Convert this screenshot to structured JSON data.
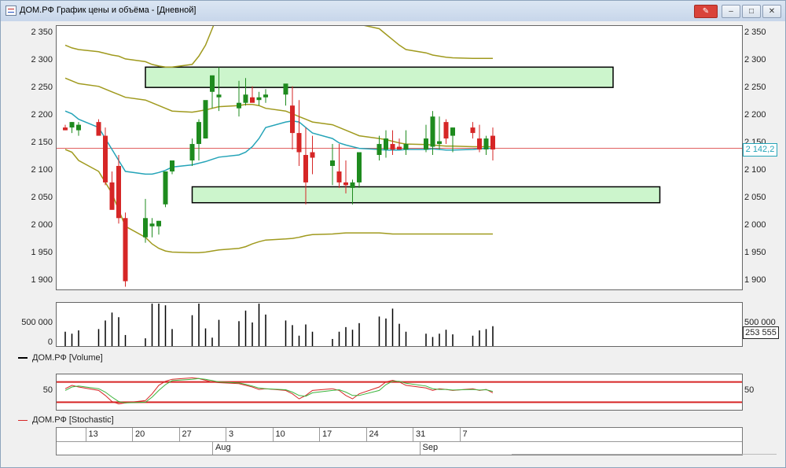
{
  "window": {
    "title": "ДОМ.РФ График цены и объёма - [Дневной]",
    "pin_icon": "pin-icon",
    "controls": {
      "minimize": "–",
      "maximize": "□",
      "close": "✕"
    }
  },
  "price_axis": {
    "ticks": [
      "2 350",
      "2 300",
      "2 250",
      "2 200",
      "2 150",
      "2 100",
      "2 050",
      "2 000",
      "1 950",
      "1 900"
    ],
    "last_price": "2 142,2",
    "last_price_color": "#25a4b8"
  },
  "volume_pane": {
    "ticks": [
      "500 000",
      "0"
    ],
    "right_ticks": [
      "500 000",
      "253 555"
    ],
    "legend": "ДОМ.РФ [Volume]"
  },
  "stochastic_pane": {
    "ticks": [
      "50"
    ],
    "right_ticks": [
      "50"
    ],
    "legend": "ДОМ.РФ [Stochastic]"
  },
  "date_axis": {
    "days": [
      "13",
      "20",
      "27",
      "3",
      "10",
      "17",
      "24",
      "31",
      "7"
    ],
    "months": [
      "Aug",
      "Sep"
    ]
  },
  "colors": {
    "up": "#1e8b1e",
    "down": "#d62626",
    "bollinger": "#a09a1e",
    "ma": "#25a4b8",
    "zone": "#ccf5cc",
    "resistance": "#d62626",
    "k_line": "#d62626",
    "d_line": "#3cb43c"
  },
  "chart_data": [
    {
      "type": "candlestick",
      "title": "ДОМ.РФ",
      "ylim": [
        1885,
        2365
      ],
      "x": [
        "2024-07-10",
        "2024-07-11",
        "2024-07-12",
        "2024-07-15",
        "2024-07-16",
        "2024-07-17",
        "2024-07-18",
        "2024-07-19",
        "2024-07-22",
        "2024-07-23",
        "2024-07-24",
        "2024-07-25",
        "2024-07-26",
        "2024-07-29",
        "2024-07-30",
        "2024-07-31",
        "2024-08-01",
        "2024-08-02",
        "2024-08-05",
        "2024-08-06",
        "2024-08-07",
        "2024-08-08",
        "2024-08-09",
        "2024-08-12",
        "2024-08-13",
        "2024-08-14",
        "2024-08-15",
        "2024-08-16",
        "2024-08-19",
        "2024-08-20",
        "2024-08-21",
        "2024-08-22",
        "2024-08-23",
        "2024-08-26",
        "2024-08-27",
        "2024-08-28",
        "2024-08-29",
        "2024-08-30",
        "2024-09-02",
        "2024-09-03",
        "2024-09-04",
        "2024-09-05",
        "2024-09-06",
        "2024-09-09",
        "2024-09-10",
        "2024-09-11",
        "2024-09-12"
      ],
      "open": [
        2180,
        2180,
        2175,
        2190,
        2165,
        2080,
        2110,
        2015,
        1980,
        2000,
        2000,
        2040,
        2100,
        2120,
        2150,
        2160,
        2245,
        2235,
        2215,
        2225,
        2235,
        2230,
        2235,
        2240,
        2220,
        2170,
        2130,
        2135,
        2110,
        2100,
        2080,
        2070,
        2080,
        2130,
        2140,
        2150,
        2145,
        2140,
        2140,
        2145,
        2150,
        2190,
        2165,
        2180,
        2160,
        2140,
        2165
      ],
      "high": [
        2185,
        2190,
        2190,
        2195,
        2180,
        2100,
        2130,
        2025,
        2050,
        2015,
        2010,
        2100,
        2120,
        2160,
        2195,
        2220,
        2275,
        2290,
        2265,
        2270,
        2255,
        2245,
        2250,
        2255,
        2255,
        2230,
        2180,
        2165,
        2150,
        2150,
        2120,
        2085,
        2115,
        2165,
        2175,
        2175,
        2160,
        2175,
        2185,
        2210,
        2200,
        2195,
        2180,
        2190,
        2185,
        2165,
        2180
      ],
      "low": [
        2175,
        2170,
        2165,
        2170,
        2075,
        2040,
        2005,
        1890,
        1970,
        1980,
        1985,
        2035,
        2095,
        2110,
        2120,
        2160,
        2215,
        2210,
        2200,
        2220,
        2230,
        2220,
        2225,
        2220,
        2140,
        2110,
        2040,
        2095,
        2075,
        2070,
        2060,
        2040,
        2070,
        2120,
        2125,
        2130,
        2140,
        2130,
        2135,
        2130,
        2140,
        2150,
        2135,
        2160,
        2135,
        2130,
        2120
      ],
      "close": [
        2175,
        2190,
        2185,
        2165,
        2080,
        2030,
        2015,
        1900,
        2015,
        2005,
        2010,
        2100,
        2120,
        2150,
        2190,
        2230,
        2275,
        2240,
        2225,
        2240,
        2225,
        2235,
        2240,
        2260,
        2170,
        2135,
        2080,
        2125,
        2120,
        2080,
        2075,
        2080,
        2135,
        2150,
        2160,
        2140,
        2140,
        2150,
        2160,
        2200,
        2155,
        2160,
        2180,
        2170,
        2140,
        2160,
        2140
      ],
      "series": [
        {
          "name": "upper",
          "values": [
            2330,
            2325,
            2322,
            2318,
            2315,
            2312,
            2310,
            2305,
            2300,
            2295,
            2292,
            2290,
            2290,
            2295,
            2310,
            2330,
            2360,
            2390,
            2420,
            2440,
            2455,
            2460,
            2462,
            2462,
            2460,
            2455,
            2445,
            2430,
            2410,
            2395,
            2385,
            2375,
            2368,
            2360,
            2350,
            2340,
            2330,
            2322,
            2316,
            2312,
            2310,
            2308,
            2307,
            2306,
            2306,
            2306,
            2306
          ]
        },
        {
          "name": "middle",
          "values": [
            2270,
            2265,
            2260,
            2255,
            2250,
            2245,
            2240,
            2235,
            2230,
            2225,
            2220,
            2215,
            2210,
            2208,
            2210,
            2212,
            2215,
            2218,
            2220,
            2222,
            2222,
            2220,
            2215,
            2210,
            2205,
            2200,
            2195,
            2190,
            2185,
            2180,
            2175,
            2170,
            2165,
            2160,
            2158,
            2155,
            2152,
            2150,
            2149,
            2148,
            2147,
            2146,
            2146,
            2145,
            2145,
            2145,
            2145
          ]
        },
        {
          "name": "lower",
          "values": [
            2140,
            2135,
            2120,
            2100,
            2080,
            2060,
            2030,
            2000,
            1980,
            1968,
            1960,
            1955,
            1953,
            1952,
            1952,
            1953,
            1955,
            1957,
            1960,
            1963,
            1968,
            1972,
            1975,
            1977,
            1978,
            1980,
            1983,
            1985,
            1986,
            1987,
            1988,
            1988,
            1988,
            1988,
            1987,
            1986,
            1986,
            1986,
            1986,
            1986,
            1986,
            1986,
            1986,
            1986,
            1986,
            1986,
            1986
          ]
        },
        {
          "name": "ma",
          "values": [
            2210,
            2205,
            2195,
            2180,
            2160,
            2140,
            2120,
            2100,
            2095,
            2095,
            2098,
            2102,
            2108,
            2112,
            2115,
            2118,
            2122,
            2126,
            2130,
            2135,
            2145,
            2160,
            2180,
            2190,
            2192,
            2190,
            2180,
            2170,
            2160,
            2152,
            2148,
            2145,
            2142,
            2140,
            2139,
            2139,
            2139,
            2140,
            2140,
            2141,
            2140,
            2139,
            2139,
            2140,
            2141,
            2142,
            2142
          ]
        }
      ],
      "last_price": 2142.2,
      "zones": [
        {
          "from": 2253,
          "to": 2290,
          "x_start": "2024-07-22",
          "x_end": "2024-09-30"
        },
        {
          "from": 2043,
          "to": 2072,
          "x_start": "2024-07-29",
          "x_end": "2024-10-07"
        }
      ]
    },
    {
      "type": "bar",
      "title": "ДОМ.РФ [Volume]",
      "ylim": [
        0,
        560000
      ],
      "values": [
        170000,
        140000,
        190000,
        210000,
        340000,
        460000,
        390000,
        120000,
        70000,
        940000,
        600000,
        570000,
        210000,
        420000,
        710000,
        220000,
        80000,
        350000,
        330000,
        490000,
        310000,
        760000,
        430000,
        340000,
        270000,
        110000,
        280000,
        170000,
        60000,
        170000,
        240000,
        200000,
        300000,
        400000,
        370000,
        520000,
        290000,
        170000,
        140000,
        90000,
        140000,
        200000,
        130000,
        110000,
        190000,
        210000,
        253555
      ]
    },
    {
      "type": "line",
      "title": "ДОМ.РФ [Stochastic]",
      "ylim": [
        0,
        100
      ],
      "levels": [
        80,
        20
      ],
      "series": [
        {
          "name": "%K",
          "values": [
            60,
            70,
            65,
            55,
            40,
            22,
            15,
            18,
            25,
            45,
            70,
            82,
            88,
            92,
            90,
            85,
            80,
            78,
            75,
            70,
            65,
            58,
            60,
            55,
            45,
            30,
            40,
            55,
            60,
            55,
            40,
            30,
            45,
            65,
            80,
            85,
            80,
            70,
            62,
            55,
            60,
            58,
            55,
            60,
            55,
            58,
            48
          ]
        },
        {
          "name": "%D",
          "values": [
            55,
            65,
            68,
            60,
            50,
            35,
            22,
            18,
            20,
            35,
            55,
            72,
            84,
            88,
            90,
            88,
            84,
            80,
            77,
            73,
            68,
            62,
            60,
            57,
            50,
            40,
            38,
            48,
            55,
            57,
            50,
            40,
            40,
            55,
            72,
            82,
            82,
            76,
            68,
            60,
            58,
            58,
            56,
            58,
            56,
            57,
            52
          ]
        }
      ]
    }
  ]
}
